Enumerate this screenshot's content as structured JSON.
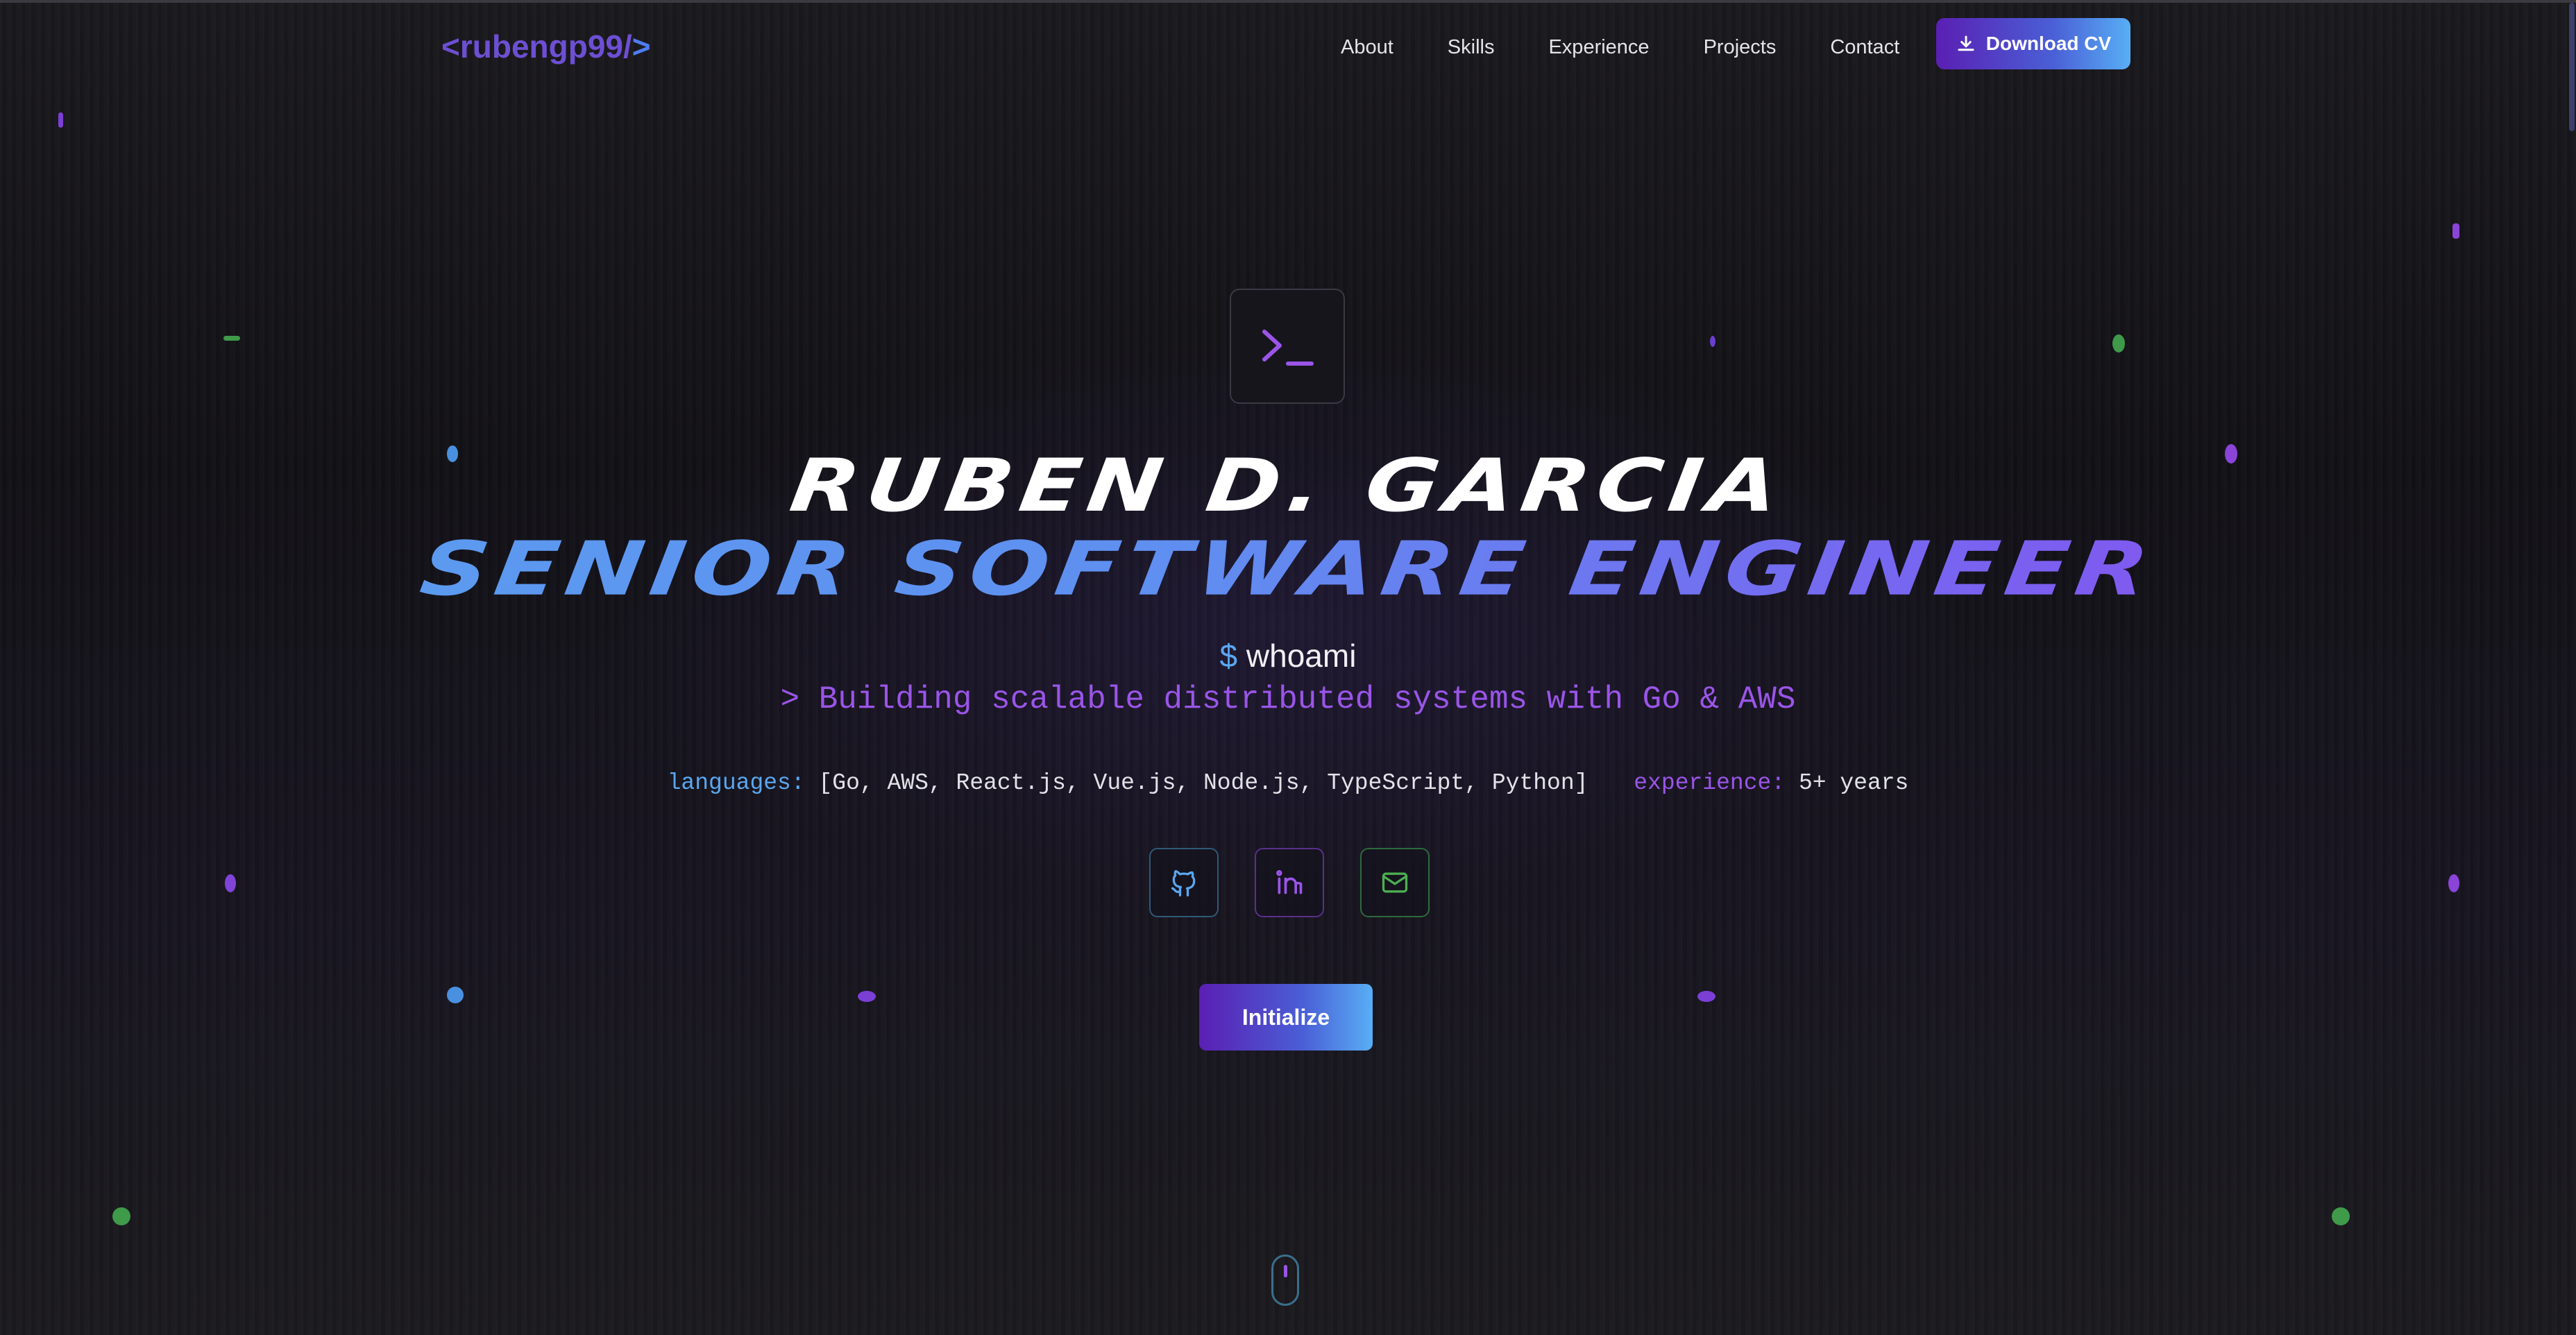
{
  "header": {
    "logo": {
      "prefix": "<rubengp99/",
      "suffix": ">"
    },
    "nav": [
      "About",
      "Skills",
      "Experience",
      "Projects",
      "Contact"
    ],
    "download_cv_label": "Download CV"
  },
  "hero": {
    "name": "RUBEN D. GARCIA",
    "role": "SENIOR SOFTWARE ENGINEER",
    "prompt_symbol": "$",
    "command": "whoami",
    "tagline": "> Building scalable distributed systems with Go & AWS",
    "languages_key": "languages:",
    "languages_value": "[Go, AWS, React.js, Vue.js, Node.js, TypeScript, Python]",
    "experience_key": "experience:",
    "experience_value": "5+ years",
    "initialize_label": "Initialize"
  },
  "icons": {
    "terminal": "terminal-icon",
    "github": "github-icon",
    "linkedin": "linkedin-icon",
    "mail": "mail-icon",
    "download": "download-icon",
    "scroll": "mouse-scroll-icon"
  },
  "colors": {
    "accent_blue": "#5aa7f0",
    "accent_purple": "#9a55e8",
    "accent_green": "#4caf50",
    "background": "#151418"
  }
}
